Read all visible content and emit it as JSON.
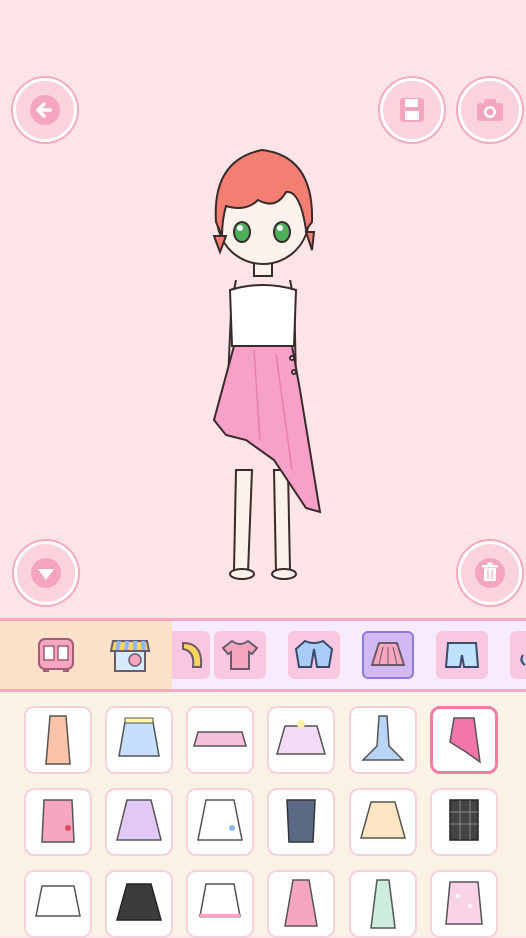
{
  "icons": {
    "back": "arrow-left-icon",
    "save": "floppy-disk-icon",
    "camera": "camera-icon",
    "collapse": "triangle-down-icon",
    "trash": "trash-icon"
  },
  "colors": {
    "background": "#fde4e6",
    "button_fill": "#fbd3dc",
    "button_ring": "#f4a9bd",
    "accent_pink": "#ef7ea0",
    "selected_tab": "#d3b9f4",
    "grid_bg": "#fbf2e6"
  },
  "categories": [
    {
      "name": "wardrobe",
      "icon": "wardrobe-icon"
    },
    {
      "name": "shop",
      "icon": "shop-icon"
    },
    {
      "name": "hair",
      "icon": "hair-icon"
    },
    {
      "name": "tops",
      "icon": "shirt-icon"
    },
    {
      "name": "jackets",
      "icon": "jacket-icon"
    },
    {
      "name": "skirts",
      "icon": "skirt-icon",
      "selected": true
    },
    {
      "name": "shorts",
      "icon": "shorts-icon"
    },
    {
      "name": "more",
      "icon": "partial-icon"
    }
  ],
  "items": [
    "peach-long-skirt-icon",
    "blue-pleated-skirt-icon",
    "pink-ruffle-tutu-icon",
    "pastel-tulle-skirt-icon",
    "blue-mermaid-skirt-icon",
    "pink-asymmetric-skirt-icon",
    "pink-bow-skirt-icon",
    "lavender-flare-skirt-icon",
    "white-clover-skirt-icon",
    "navy-pencil-skirt-icon",
    "cream-bow-skirt-icon",
    "black-plaid-skirt-icon",
    "white-frill-skirt-icon",
    "black-pleated-skirt-icon",
    "white-pink-hem-skirt-icon",
    "pink-long-skirt-icon",
    "mint-long-skirt-icon",
    "pink-dot-skirt-icon"
  ],
  "selected_item_index": 5
}
